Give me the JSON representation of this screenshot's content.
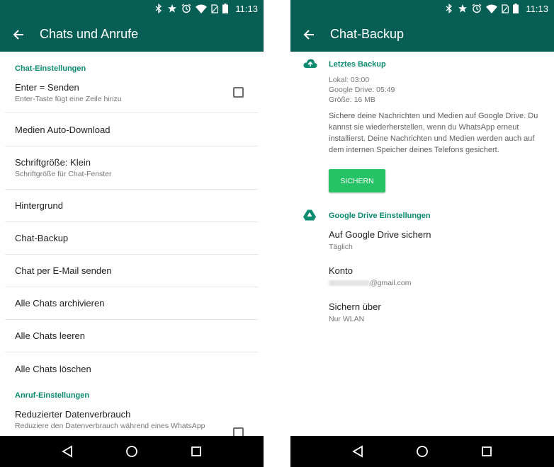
{
  "status_bar": {
    "time": "11:13",
    "icons": [
      "bluetooth-icon",
      "star-icon",
      "alarm-icon",
      "wifi-icon",
      "battery-icon"
    ]
  },
  "colors": {
    "primary": "#075e54",
    "accent": "#0a8a6f",
    "button": "#25c366"
  },
  "left": {
    "title": "Chats und Anrufe",
    "sections": [
      {
        "header": "Chat-Einstellungen"
      },
      {
        "header": "Anruf-Einstellungen"
      }
    ],
    "items": [
      {
        "title": "Enter = Senden",
        "subtitle": "Enter-Taste fügt eine Zeile hinzu",
        "checked": false
      },
      {
        "title": "Medien Auto-Download"
      },
      {
        "title": "Schriftgröße: Klein",
        "subtitle": "Schriftgröße für Chat-Fenster"
      },
      {
        "title": "Hintergrund"
      },
      {
        "title": "Chat-Backup"
      },
      {
        "title": "Chat per E-Mail senden"
      },
      {
        "title": "Alle Chats archivieren"
      },
      {
        "title": "Alle Chats leeren"
      },
      {
        "title": "Alle Chats löschen"
      },
      {
        "title": "Reduzierter Datenverbrauch",
        "subtitle": "Reduziere den Datenverbrauch während eines WhatsApp",
        "checked": false
      }
    ]
  },
  "right": {
    "title": "Chat-Backup",
    "backup": {
      "header": "Letztes Backup",
      "lines": [
        "Lokal: 03:00",
        "Google Drive: 05:49",
        "Größe: 16 MB"
      ],
      "description": "Sichere deine Nachrichten und Medien auf Google Drive. Du kannst sie wiederherstellen, wenn du WhatsApp erneut installierst. Deine Nachrichten und Medien werden auch auf dem internen Speicher deines Telefons gesichert.",
      "button": "SICHERN"
    },
    "drive": {
      "header": "Google Drive Einstellungen",
      "items": [
        {
          "title": "Auf Google Drive sichern",
          "subtitle": "Täglich"
        },
        {
          "title": "Konto",
          "subtitle": "@gmail.com"
        },
        {
          "title": "Sichern über",
          "subtitle": "Nur WLAN"
        }
      ]
    }
  },
  "nav": {
    "icons": [
      "back-triangle-icon",
      "home-circle-icon",
      "recents-square-icon"
    ]
  }
}
